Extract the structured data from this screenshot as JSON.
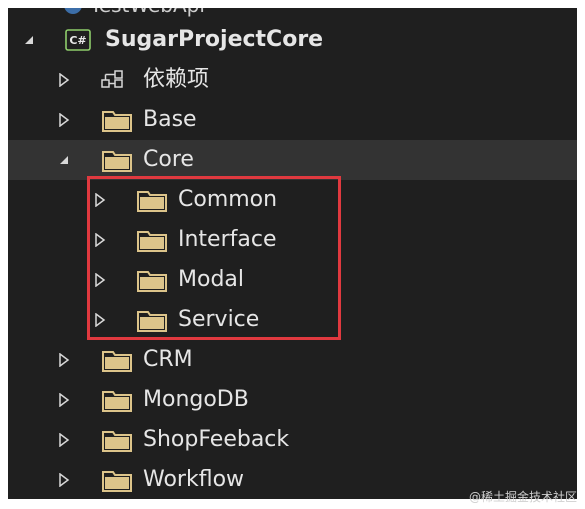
{
  "colors": {
    "background": "#1f1f1f",
    "selected_row": "#333333",
    "text": "#e6e6e6",
    "folder": "#dcc48a",
    "highlight_box": "#e0393f"
  },
  "tree": {
    "partial_top_label": "TestWebApi",
    "project": {
      "label": "SugarProjectCore",
      "icon": "csharp-project-icon",
      "badge": "C#",
      "expanded": true
    },
    "dependencies": {
      "label": "依赖项",
      "icon": "dependencies-icon"
    },
    "folders": [
      {
        "label": "Base",
        "expanded": false
      },
      {
        "label": "Core",
        "expanded": true,
        "selected": true,
        "children": [
          {
            "label": "Common"
          },
          {
            "label": "Interface"
          },
          {
            "label": "Modal"
          },
          {
            "label": "Service"
          }
        ]
      },
      {
        "label": "CRM",
        "expanded": false
      },
      {
        "label": "MongoDB",
        "expanded": false
      },
      {
        "label": "ShopFeeback",
        "expanded": false
      },
      {
        "label": "Workflow",
        "expanded": false
      }
    ]
  },
  "watermark": "@稀土掘金技术社区"
}
